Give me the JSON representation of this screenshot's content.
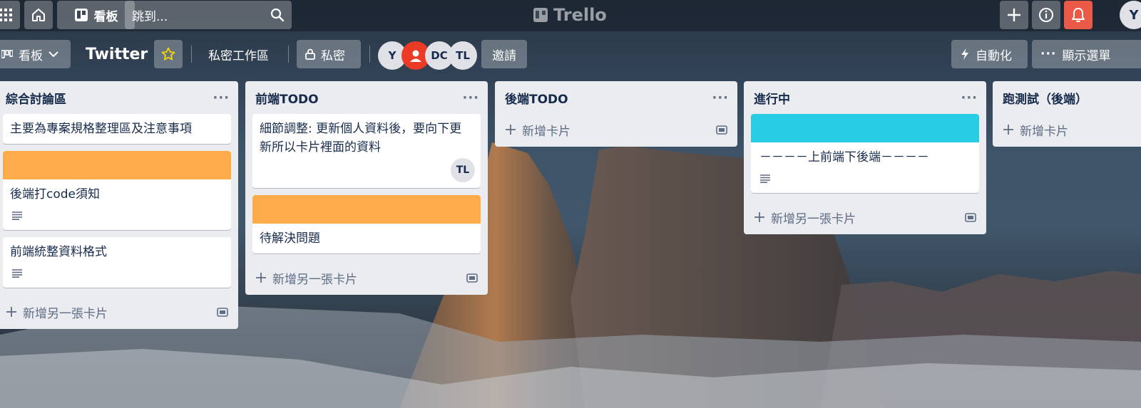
{
  "topbar": {
    "board_label": "看板",
    "search_placeholder": "跳到...",
    "logo_text": "Trello",
    "user_initial": "Y",
    "notification_color": "#eb5a46"
  },
  "board": {
    "view_label": "看板",
    "title": "Twitter",
    "workspace": "私密工作區",
    "visibility": "私密",
    "members": [
      "Y",
      "",
      "DC",
      "TL"
    ],
    "invite_label": "邀請",
    "automation_label": "自動化",
    "menu_label": "顯示選單"
  },
  "lists": [
    {
      "title": "綜合討論區",
      "cards": [
        {
          "text": "主要為專案規格整理區及注意事項"
        },
        {
          "text": "後端打code須知",
          "cover": "#ffab4a"
        },
        {
          "text": "前端統整資料格式"
        }
      ],
      "add_label": "新增另一張卡片"
    },
    {
      "title": "前端TODO",
      "cards": [
        {
          "text": "細節調整: 更新個人資料後，要向下更新所以卡片裡面的資料",
          "member": "TL"
        },
        {
          "text": "待解決問題",
          "cover": "#ffab4a"
        }
      ],
      "add_label": "新增另一張卡片"
    },
    {
      "title": "後端TODO",
      "cards": [],
      "add_label": "新增卡片"
    },
    {
      "title": "進行中",
      "cards": [
        {
          "text": "－－－－上前端下後端－－－－",
          "cover": "#29cce5"
        }
      ],
      "add_label": "新增另一張卡片"
    },
    {
      "title": "跑測試（後端）",
      "cards": [],
      "add_label": "新增卡片"
    }
  ]
}
